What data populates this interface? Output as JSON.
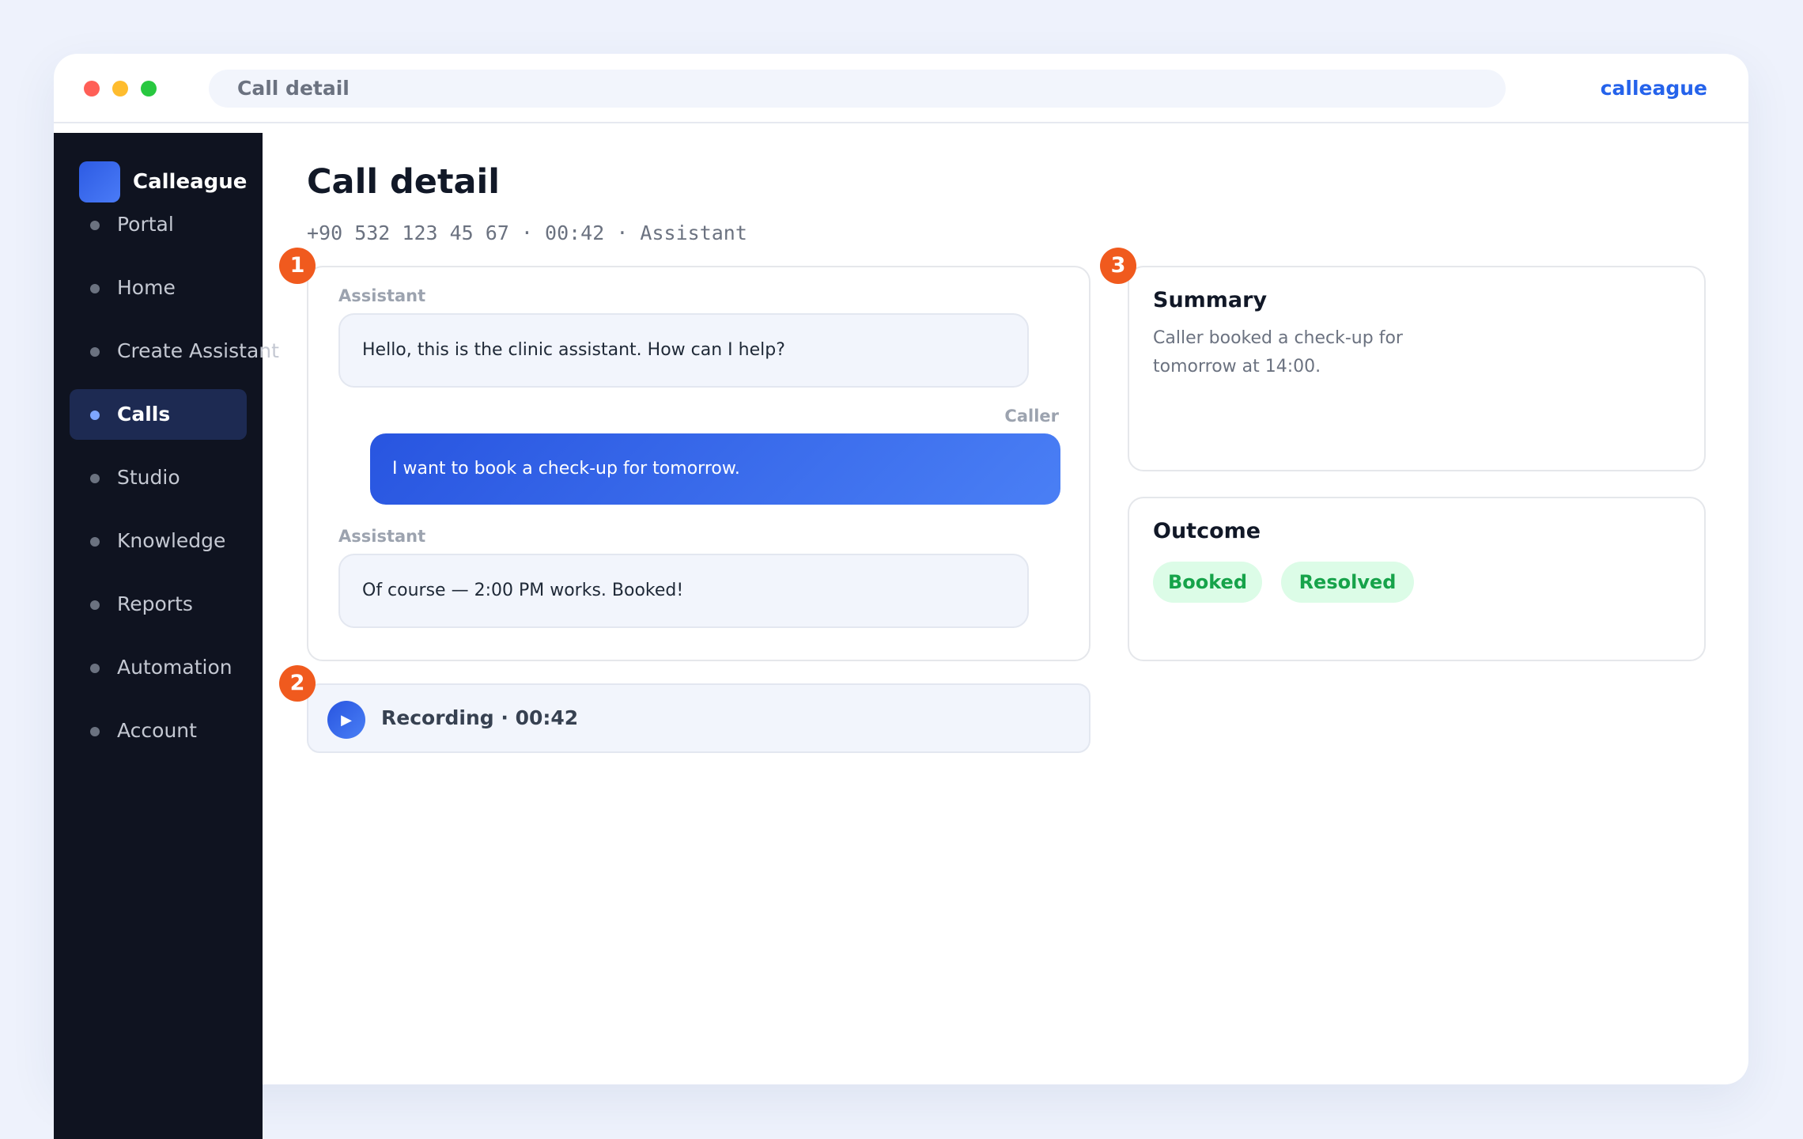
{
  "window": {
    "url_title": "Call detail",
    "brand_link": "calleague"
  },
  "sidebar": {
    "app_name": "Calleague",
    "items": [
      {
        "label": "Portal"
      },
      {
        "label": "Home"
      },
      {
        "label": "Create Assistant"
      },
      {
        "label": "Calls",
        "active": true
      },
      {
        "label": "Studio"
      },
      {
        "label": "Knowledge"
      },
      {
        "label": "Reports"
      },
      {
        "label": "Automation"
      },
      {
        "label": "Account"
      }
    ]
  },
  "main": {
    "title": "Call detail",
    "subtitle": "+90 532 123 45 67 · 00:42 · Assistant",
    "step_badges": [
      "1",
      "2",
      "3"
    ],
    "transcript": [
      {
        "speaker": "Assistant",
        "text": "Hello, this is the clinic assistant. How can I help?"
      },
      {
        "speaker": "Caller",
        "text": "I want to book a check-up for tomorrow."
      },
      {
        "speaker": "Assistant",
        "text": "Of course — 2:00 PM works. Booked!"
      }
    ],
    "recording": {
      "play_icon": "▶",
      "label": "Recording · 00:42"
    },
    "summary": {
      "title": "Summary",
      "text": "Caller booked a check-up for tomorrow at 14:00."
    },
    "outcome": {
      "title": "Outcome",
      "tags": [
        "Booked",
        "Resolved"
      ]
    }
  },
  "colors": {
    "accent": "#2563eb",
    "sidebar_bg": "#0f1320",
    "badge": "#f05a1e",
    "tag_bg": "#dcfce7",
    "tag_text": "#16a34a"
  }
}
